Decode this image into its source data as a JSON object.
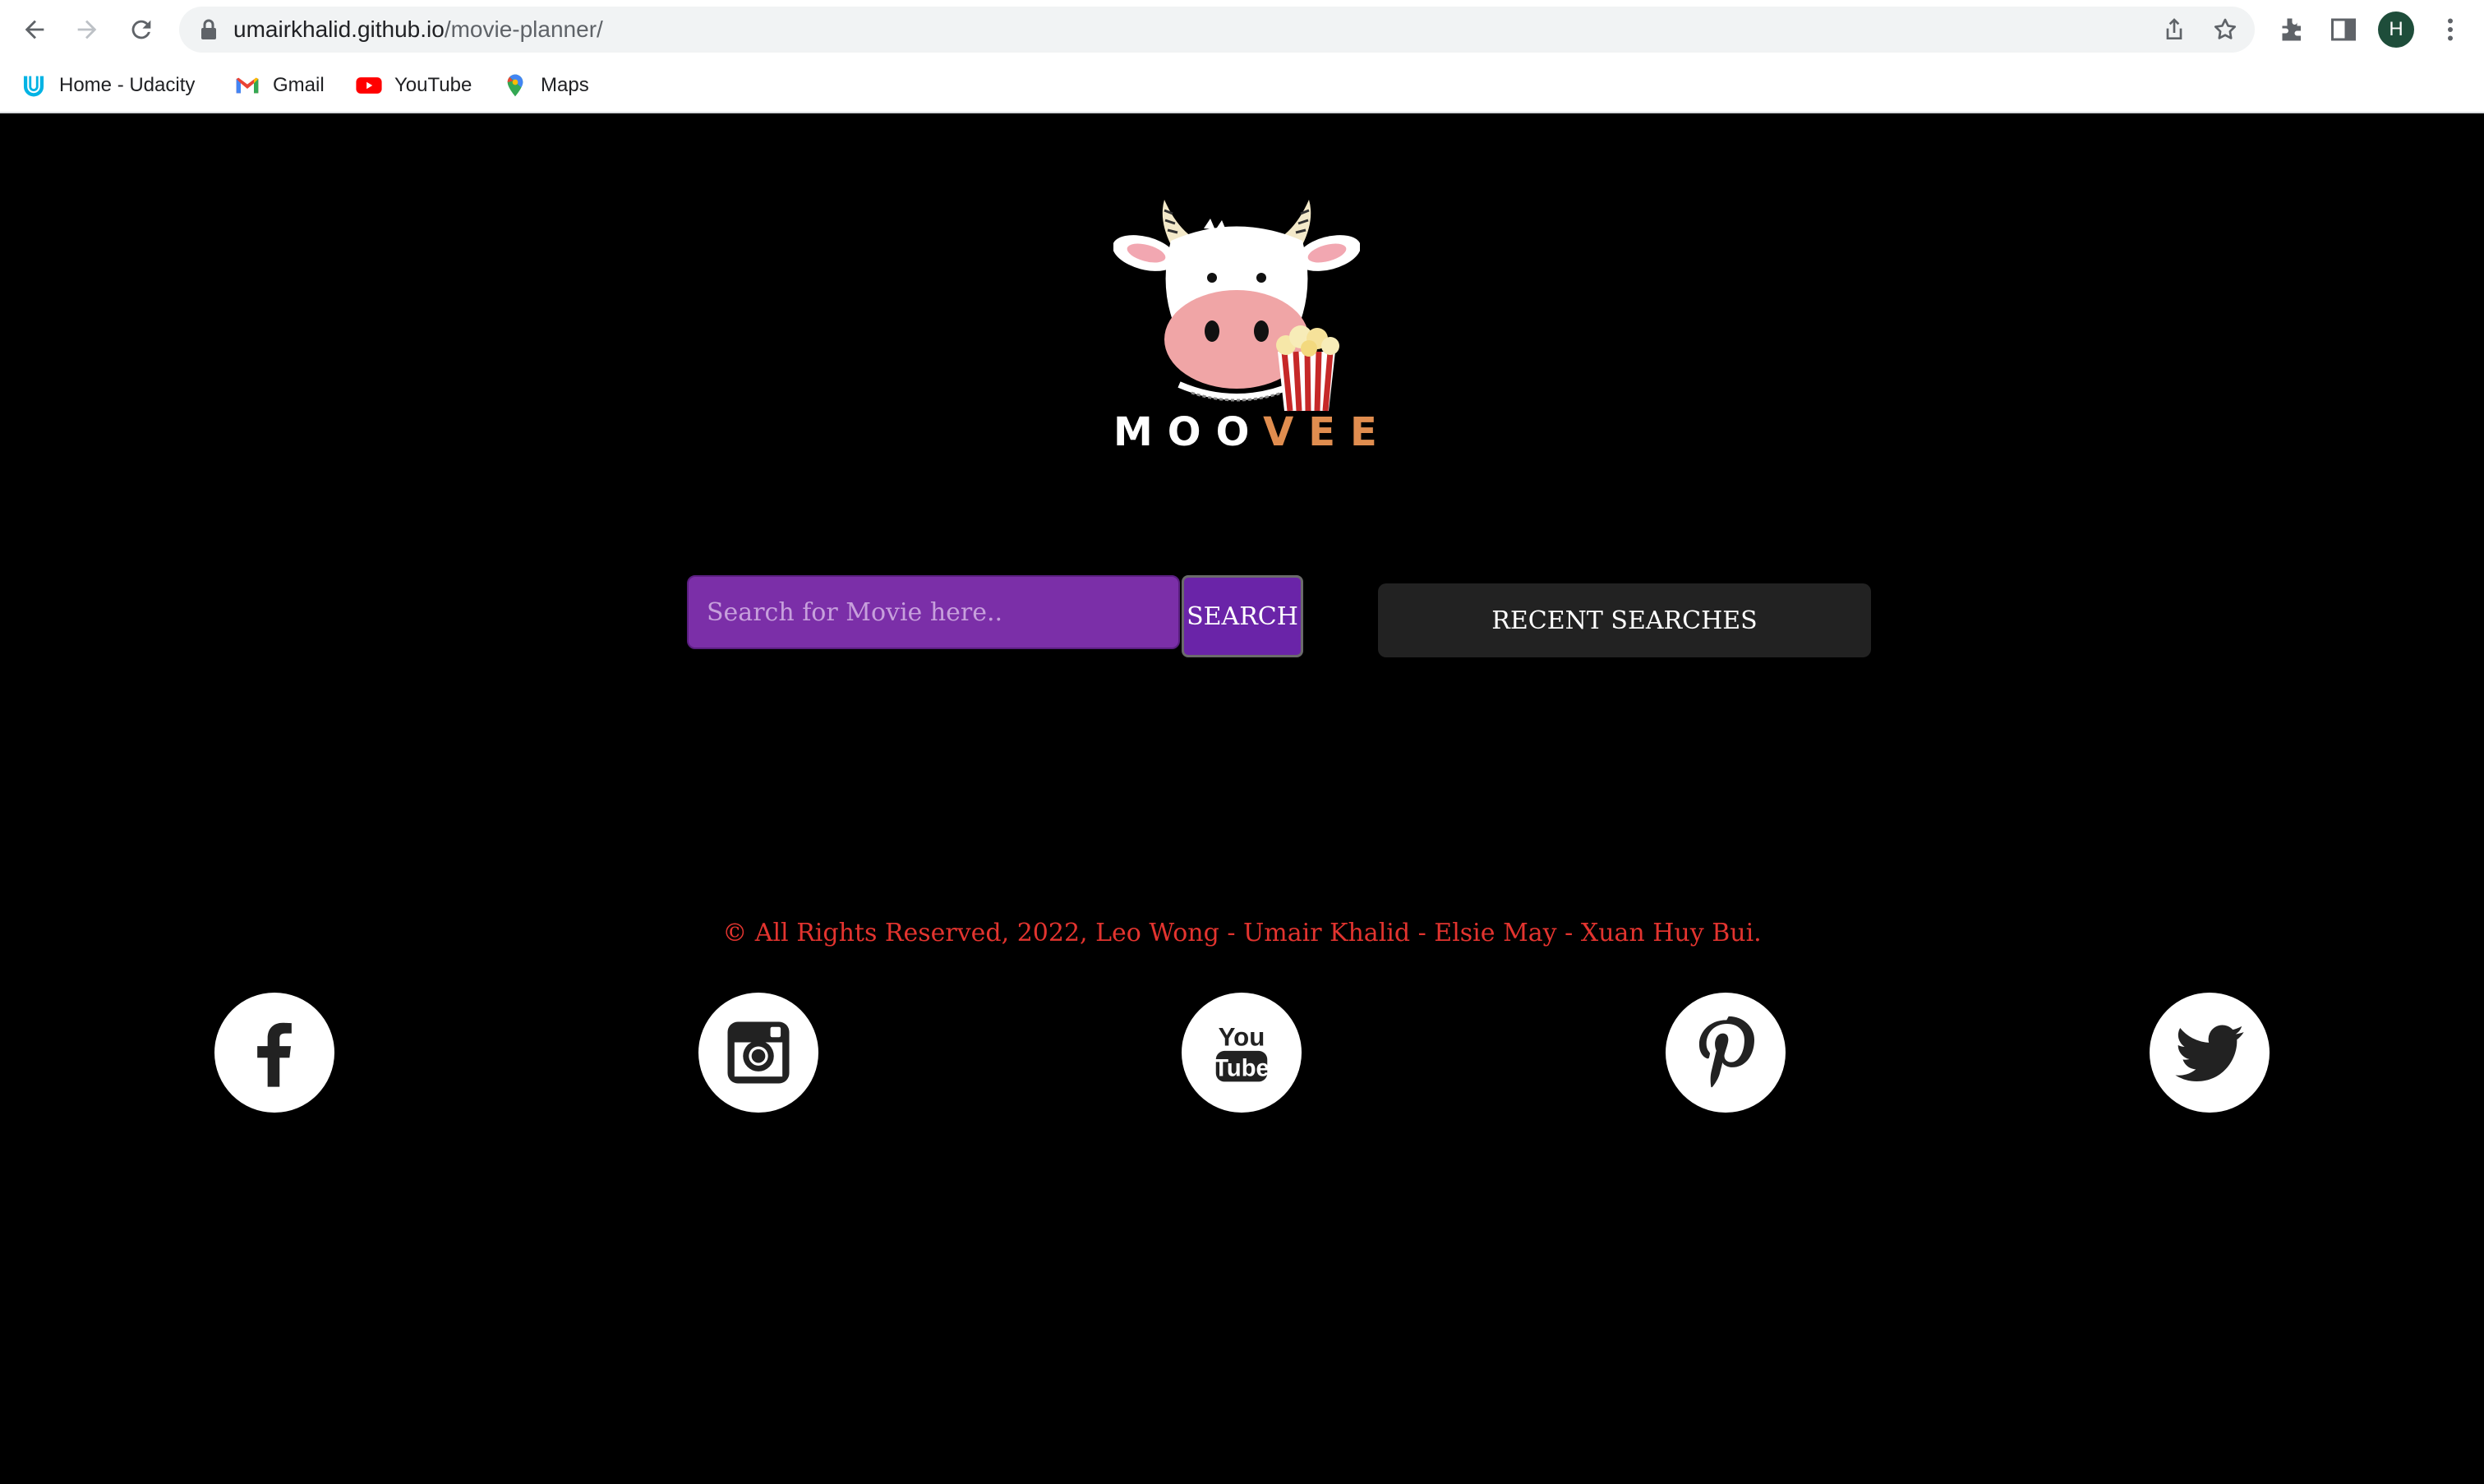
{
  "browser": {
    "url_host": "umairkhalid.github.io",
    "url_path": "/movie-planner/",
    "profile_initial": "H",
    "icons": [
      "back-icon",
      "forward-icon",
      "reload-icon",
      "lock-icon",
      "share-icon",
      "star-icon",
      "extensions-icon",
      "side-panel-icon",
      "menu-icon"
    ]
  },
  "bookmarks": [
    {
      "label": "Home - Udacity",
      "icon": "udacity-icon"
    },
    {
      "label": "Gmail",
      "icon": "gmail-icon"
    },
    {
      "label": "YouTube",
      "icon": "youtube-icon"
    },
    {
      "label": "Maps",
      "icon": "maps-icon"
    }
  ],
  "logo": {
    "text_white": "MOO",
    "text_orange": "VEE"
  },
  "search": {
    "placeholder": "Search for Movie here..",
    "button_label": "SEARCH",
    "recent_label": "RECENT SEARCHES"
  },
  "footer": {
    "copyright": "© All Rights Reserved, 2022, Leo Wong - Umair Khalid - Elsie May - Xuan Huy Bui."
  },
  "social": [
    "facebook-icon",
    "instagram-icon",
    "youtube-icon",
    "pinterest-icon",
    "twitter-icon"
  ],
  "colors": {
    "background": "#000000",
    "search_purple": "#7b2fa8",
    "button_purple": "#6a24a8",
    "recent_gray": "#222222",
    "copyright_red": "#e3342f",
    "logo_orange": "#e08d4f"
  }
}
